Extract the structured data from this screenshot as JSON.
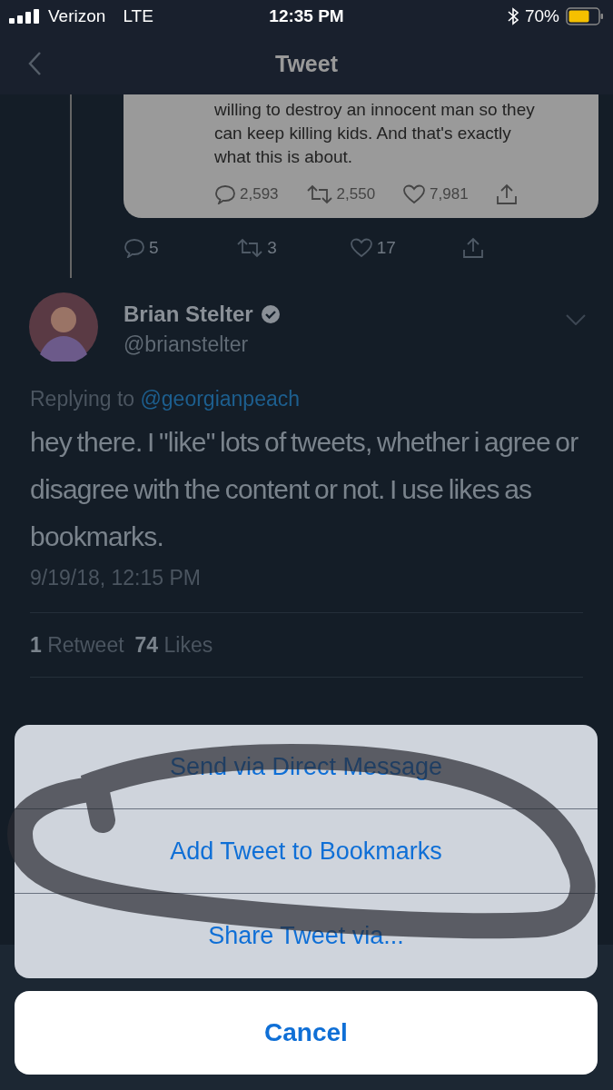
{
  "status_bar": {
    "carrier": "Verizon",
    "network": "LTE",
    "time": "12:35 PM",
    "battery": "70%"
  },
  "nav": {
    "title": "Tweet"
  },
  "quoted_tweet": {
    "text": "willing to destroy an innocent man so they can keep killing kids.  And that's exactly what this is about.",
    "replies": "2,593",
    "retweets": "2,550",
    "likes": "7,981"
  },
  "parent_actions": {
    "replies": "5",
    "retweets": "3",
    "likes": "17"
  },
  "tweet": {
    "name": "Brian Stelter",
    "verified": true,
    "handle": "@brianstelter",
    "replying_label": "Replying to",
    "replying_to": "@georgianpeach",
    "text": "hey there. I \"like\" lots of tweets, whether i agree or disagree with the content or not. I use likes as bookmarks.",
    "timestamp": "9/19/18, 12:15 PM",
    "retweets_count": "1",
    "retweets_label": "Retweet",
    "likes_count": "74",
    "likes_label": "Likes"
  },
  "action_sheet": {
    "options": [
      "Send via Direct Message",
      "Add Tweet to Bookmarks",
      "Share Tweet via..."
    ],
    "cancel": "Cancel"
  }
}
